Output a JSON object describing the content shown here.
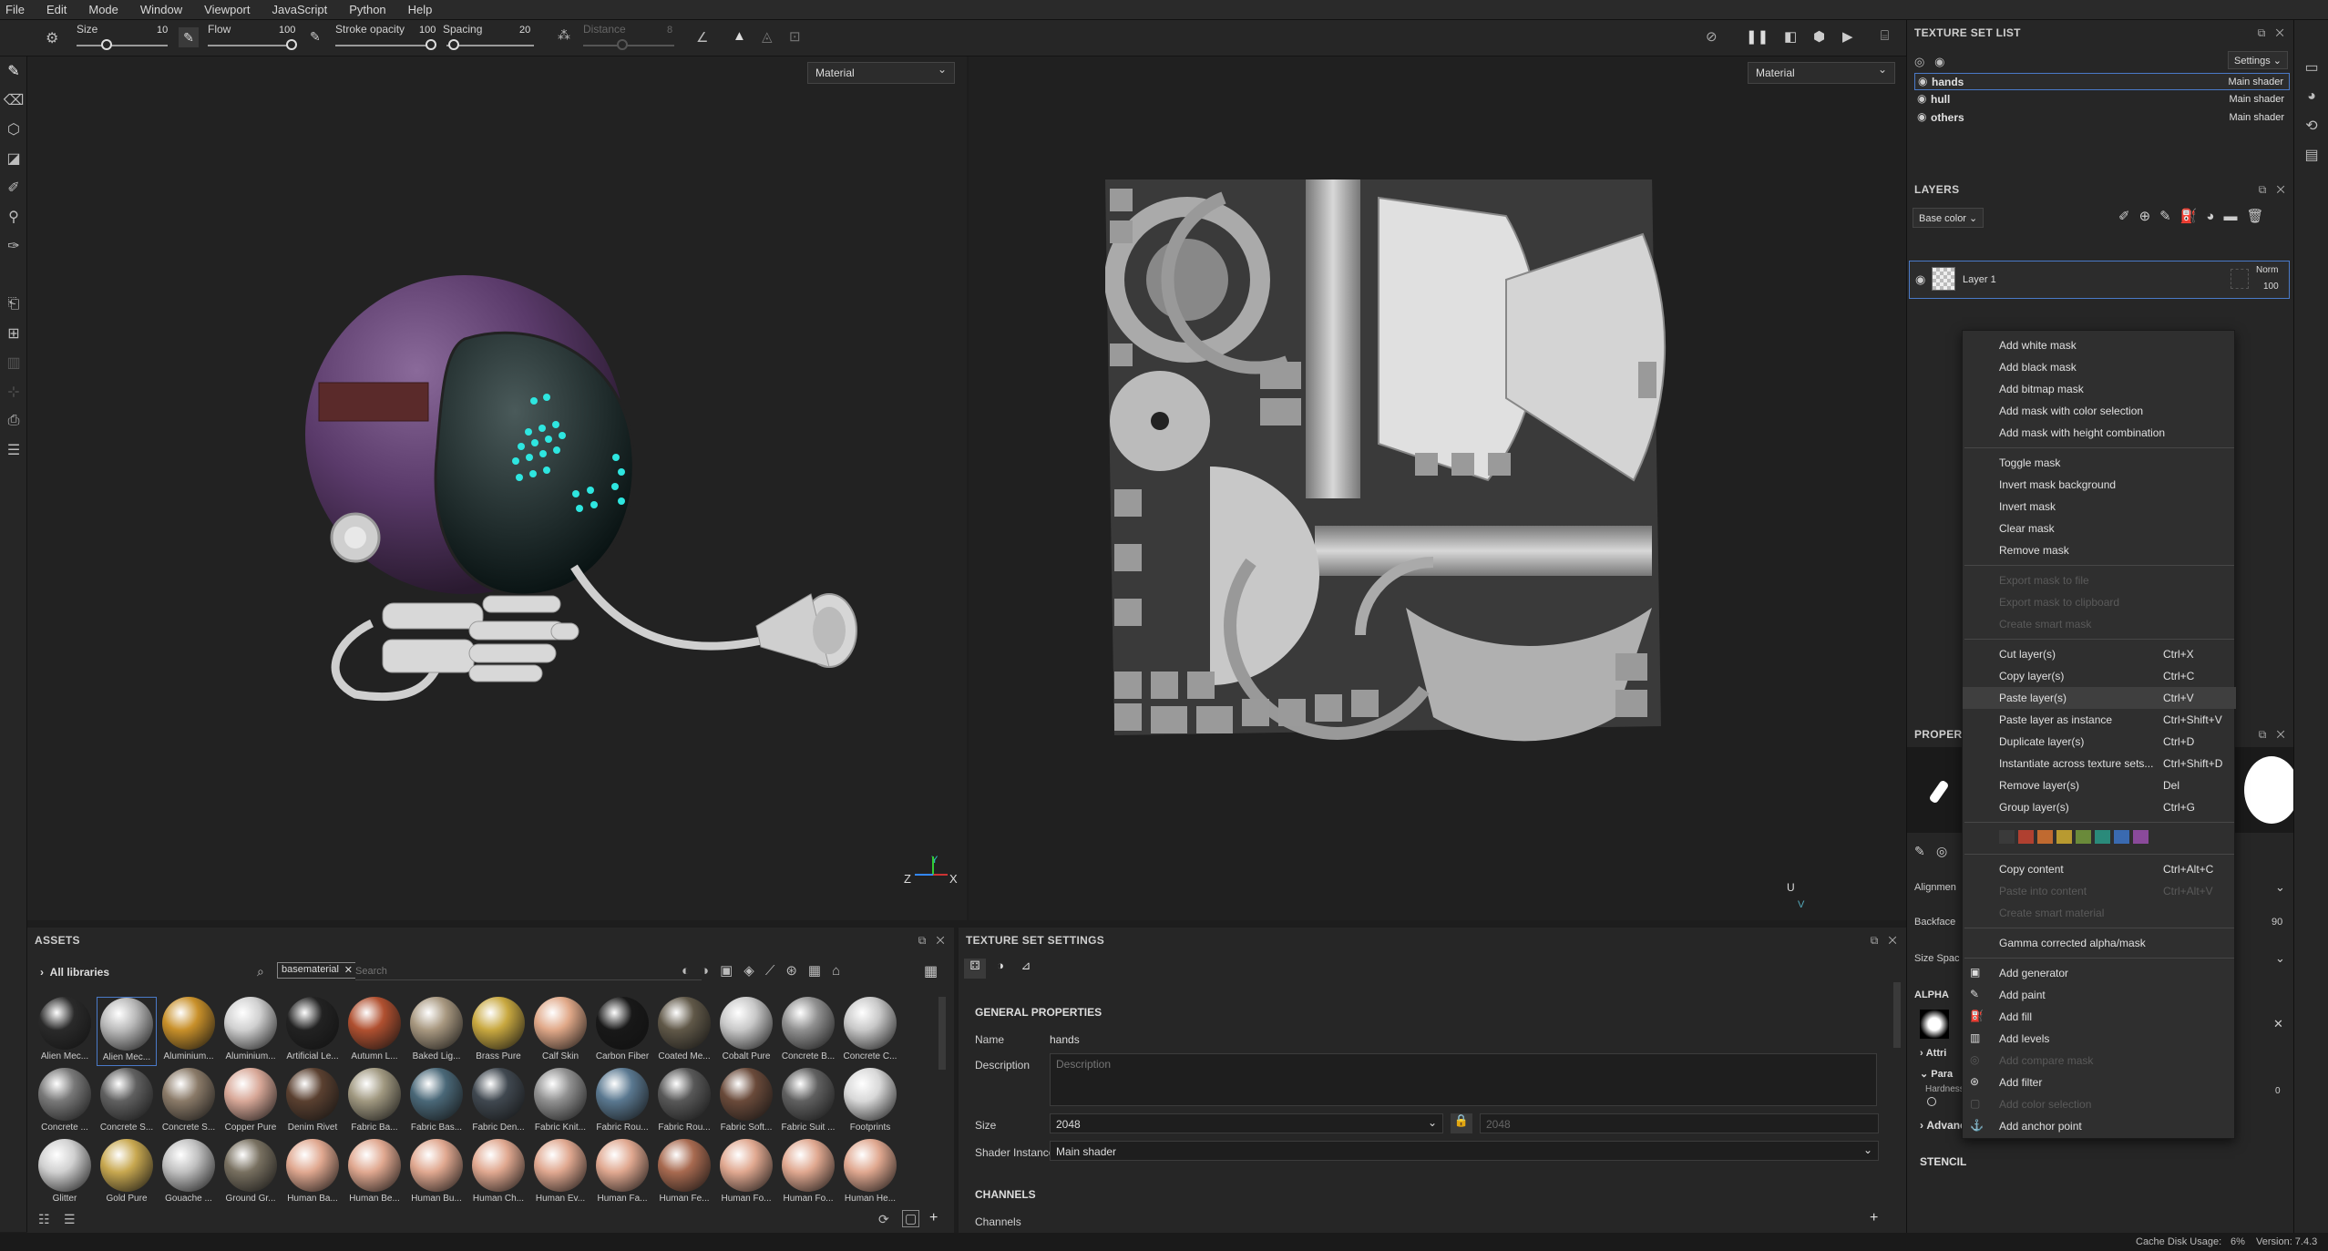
{
  "menu": [
    "File",
    "Edit",
    "Mode",
    "Window",
    "Viewport",
    "JavaScript",
    "Python",
    "Help"
  ],
  "toolbar": {
    "size_label": "Size",
    "size_value": "10",
    "flow_label": "Flow",
    "flow_value": "100",
    "stroke_opacity_label": "Stroke opacity",
    "stroke_opacity_value": "100",
    "spacing_label": "Spacing",
    "spacing_value": "20",
    "distance_label": "Distance",
    "distance_value": "8"
  },
  "viewports": {
    "left_mode": "Material",
    "right_mode": "Material",
    "left_axis_z": "Z",
    "left_axis_y": "Y",
    "left_axis_x": "X",
    "right_axis_u": "U",
    "right_axis_v": "V"
  },
  "texture_set_list": {
    "title": "TEXTURE SET LIST",
    "settings": "Settings",
    "rows": [
      {
        "name": "hands",
        "shader": "Main shader"
      },
      {
        "name": "hull",
        "shader": "Main shader"
      },
      {
        "name": "others",
        "shader": "Main shader"
      }
    ]
  },
  "layers": {
    "title": "LAYERS",
    "channel": "Base color",
    "layer_name": "Layer 1",
    "blend": "Norm",
    "opacity": "100"
  },
  "properties": {
    "title": "PROPERT",
    "alignment": "Alignmen",
    "backface": "Backface",
    "size_space": "Size Spac",
    "backface_value": "90",
    "alpha": "ALPHA",
    "attributes": "Attri",
    "parameters": "Para",
    "hardness": "Hardness",
    "hardness_value": "0",
    "advanced_blending": "Advanced Blending",
    "stencil": "STENCIL"
  },
  "context_menu": {
    "items": [
      {
        "label": "Add white mask",
        "shortcut": "",
        "disabled": false
      },
      {
        "label": "Add black mask",
        "shortcut": "",
        "disabled": false
      },
      {
        "label": "Add bitmap mask",
        "shortcut": "",
        "disabled": false
      },
      {
        "label": "Add mask with color selection",
        "shortcut": "",
        "disabled": false
      },
      {
        "label": "Add mask with height combination",
        "shortcut": "",
        "disabled": false
      },
      {
        "label": "Toggle mask",
        "shortcut": "",
        "disabled": false
      },
      {
        "label": "Invert mask background",
        "shortcut": "",
        "disabled": false
      },
      {
        "label": "Invert mask",
        "shortcut": "",
        "disabled": false
      },
      {
        "label": "Clear mask",
        "shortcut": "",
        "disabled": false
      },
      {
        "label": "Remove mask",
        "shortcut": "",
        "disabled": false
      },
      {
        "label": "Export mask to file",
        "shortcut": "",
        "disabled": true
      },
      {
        "label": "Export mask to clipboard",
        "shortcut": "",
        "disabled": true
      },
      {
        "label": "Create smart mask",
        "shortcut": "",
        "disabled": true
      },
      {
        "label": "Cut layer(s)",
        "shortcut": "Ctrl+X",
        "disabled": false
      },
      {
        "label": "Copy layer(s)",
        "shortcut": "Ctrl+C",
        "disabled": false
      },
      {
        "label": "Paste layer(s)",
        "shortcut": "Ctrl+V",
        "disabled": false
      },
      {
        "label": "Paste layer as instance",
        "shortcut": "Ctrl+Shift+V",
        "disabled": false
      },
      {
        "label": "Duplicate layer(s)",
        "shortcut": "Ctrl+D",
        "disabled": false
      },
      {
        "label": "Instantiate across texture sets...",
        "shortcut": "Ctrl+Shift+D",
        "disabled": false
      },
      {
        "label": "Remove layer(s)",
        "shortcut": "Del",
        "disabled": false
      },
      {
        "label": "Group layer(s)",
        "shortcut": "Ctrl+G",
        "disabled": false
      },
      {
        "label": "Copy content",
        "shortcut": "Ctrl+Alt+C",
        "disabled": false
      },
      {
        "label": "Paste into content",
        "shortcut": "Ctrl+Alt+V",
        "disabled": true
      },
      {
        "label": "Create smart material",
        "shortcut": "",
        "disabled": true
      },
      {
        "label": "Gamma corrected alpha/mask",
        "shortcut": "",
        "disabled": false
      },
      {
        "label": "Add generator",
        "shortcut": "",
        "disabled": false
      },
      {
        "label": "Add paint",
        "shortcut": "",
        "disabled": false
      },
      {
        "label": "Add fill",
        "shortcut": "",
        "disabled": false
      },
      {
        "label": "Add levels",
        "shortcut": "",
        "disabled": false
      },
      {
        "label": "Add compare mask",
        "shortcut": "",
        "disabled": true
      },
      {
        "label": "Add filter",
        "shortcut": "",
        "disabled": false
      },
      {
        "label": "Add color selection",
        "shortcut": "",
        "disabled": true
      },
      {
        "label": "Add anchor point",
        "shortcut": "",
        "disabled": false
      }
    ],
    "swatches": [
      "#3a3a3a",
      "#b04030",
      "#c06a30",
      "#b89a30",
      "#6a8a3a",
      "#2a8a7a",
      "#3a6ab0",
      "#8a4a9a"
    ]
  },
  "assets": {
    "title": "ASSETS",
    "library": "All libraries",
    "filter_tag": "basematerial",
    "search_placeholder": "Search",
    "items": [
      {
        "label": "Alien Mec...",
        "color": "#2a2a2a"
      },
      {
        "label": "Alien Mec...",
        "color": "#b8b8b8"
      },
      {
        "label": "Aluminium...",
        "color": "#c8902a"
      },
      {
        "label": "Aluminium...",
        "color": "#d0d0d0"
      },
      {
        "label": "Artificial Le...",
        "color": "#222222"
      },
      {
        "label": "Autumn L...",
        "color": "#b05030"
      },
      {
        "label": "Baked Lig...",
        "color": "#a89880"
      },
      {
        "label": "Brass Pure",
        "color": "#c8a840"
      },
      {
        "label": "Calf Skin",
        "color": "#e0a888"
      },
      {
        "label": "Carbon Fiber",
        "color": "#181818"
      },
      {
        "label": "Coated Me...",
        "color": "#605848"
      },
      {
        "label": "Cobalt Pure",
        "color": "#c8c8c8"
      },
      {
        "label": "Concrete B...",
        "color": "#909090"
      },
      {
        "label": "Concrete C...",
        "color": "#c8c8c8"
      },
      {
        "label": "Concrete ...",
        "color": "#787878"
      },
      {
        "label": "Concrete S...",
        "color": "#606060"
      },
      {
        "label": "Concrete S...",
        "color": "#8a7a68"
      },
      {
        "label": "Copper Pure",
        "color": "#d8a898"
      },
      {
        "label": "Denim Rivet",
        "color": "#5a4030"
      },
      {
        "label": "Fabric Ba...",
        "color": "#a09880"
      },
      {
        "label": "Fabric Bas...",
        "color": "#4a6878"
      },
      {
        "label": "Fabric Den...",
        "color": "#404850"
      },
      {
        "label": "Fabric Knit...",
        "color": "#909090"
      },
      {
        "label": "Fabric Rou...",
        "color": "#5a7890"
      },
      {
        "label": "Fabric Rou...",
        "color": "#585858"
      },
      {
        "label": "Fabric Soft...",
        "color": "#6a4a3a"
      },
      {
        "label": "Fabric Suit ...",
        "color": "#606060"
      },
      {
        "label": "Footprints",
        "color": "#d8d8d8"
      },
      {
        "label": "Glitter",
        "color": "#d0d0d0"
      },
      {
        "label": "Gold Pure",
        "color": "#c8a850"
      },
      {
        "label": "Gouache ...",
        "color": "#c0c0c0"
      },
      {
        "label": "Ground Gr...",
        "color": "#787060"
      },
      {
        "label": "Human Ba...",
        "color": "#e0a890"
      },
      {
        "label": "Human Be...",
        "color": "#e0a890"
      },
      {
        "label": "Human Bu...",
        "color": "#e0a890"
      },
      {
        "label": "Human Ch...",
        "color": "#e0a890"
      },
      {
        "label": "Human Ev...",
        "color": "#e0a890"
      },
      {
        "label": "Human Fa...",
        "color": "#e0a890"
      },
      {
        "label": "Human Fe...",
        "color": "#a86a50"
      },
      {
        "label": "Human Fo...",
        "color": "#e0a890"
      },
      {
        "label": "Human Fo...",
        "color": "#e0a890"
      },
      {
        "label": "Human He...",
        "color": "#e0a890"
      }
    ]
  },
  "texture_set_settings": {
    "title": "TEXTURE SET SETTINGS",
    "general": "GENERAL PROPERTIES",
    "name_label": "Name",
    "name_value": "hands",
    "description_label": "Description",
    "description_placeholder": "Description",
    "size_label": "Size",
    "size_value": "2048",
    "size_value2": "2048",
    "shader_label": "Shader Instance",
    "shader_value": "Main shader",
    "channels_header": "CHANNELS",
    "channels_label": "Channels"
  },
  "status": {
    "cache": "Cache Disk Usage:",
    "cache_value": "6%",
    "version": "Version: 7.4.3"
  }
}
